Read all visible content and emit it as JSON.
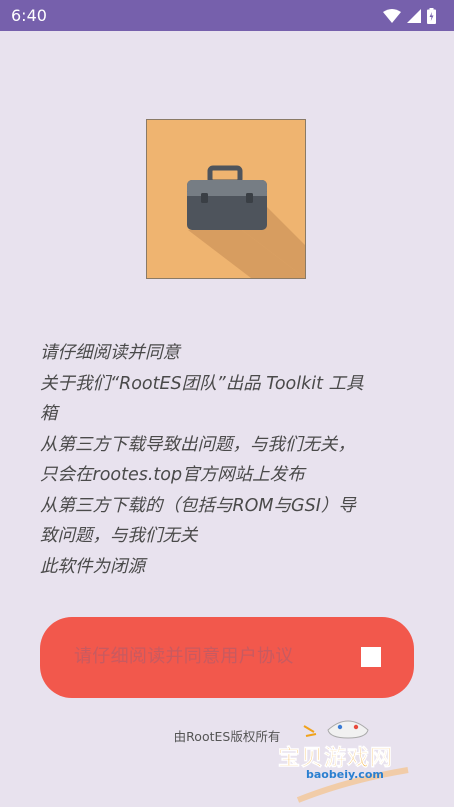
{
  "status_bar": {
    "time": "6:40",
    "icons": [
      "wifi-icon",
      "cell-signal-icon",
      "battery-charging-icon"
    ],
    "colors": {
      "background": "#7660ac"
    }
  },
  "app": {
    "icon": "toolbox-icon",
    "colors": {
      "icon_background": "#efb470",
      "toolbox_body": "#4e545c",
      "button": "#f2584c",
      "page_background": "#e8e2ee"
    }
  },
  "agreement": {
    "lines": [
      "请仔细阅读并同意",
      "关于我们“RootES团队”出品 Toolkit 工具",
      "箱",
      "从第三方下载导致出问题，与我们无关，",
      "只会在rootes.top官方网站上发布",
      "从第三方下载的（包括与ROM与GSI）导",
      "致问题，与我们无关",
      "此软件为闭源"
    ]
  },
  "agree_button": {
    "label": "请仔细阅读并同意用户协议",
    "checked": false
  },
  "footer": {
    "text": "由RootES版权所有"
  },
  "watermark": {
    "title": "宝贝游戏网",
    "url": "baobeiy.com"
  }
}
